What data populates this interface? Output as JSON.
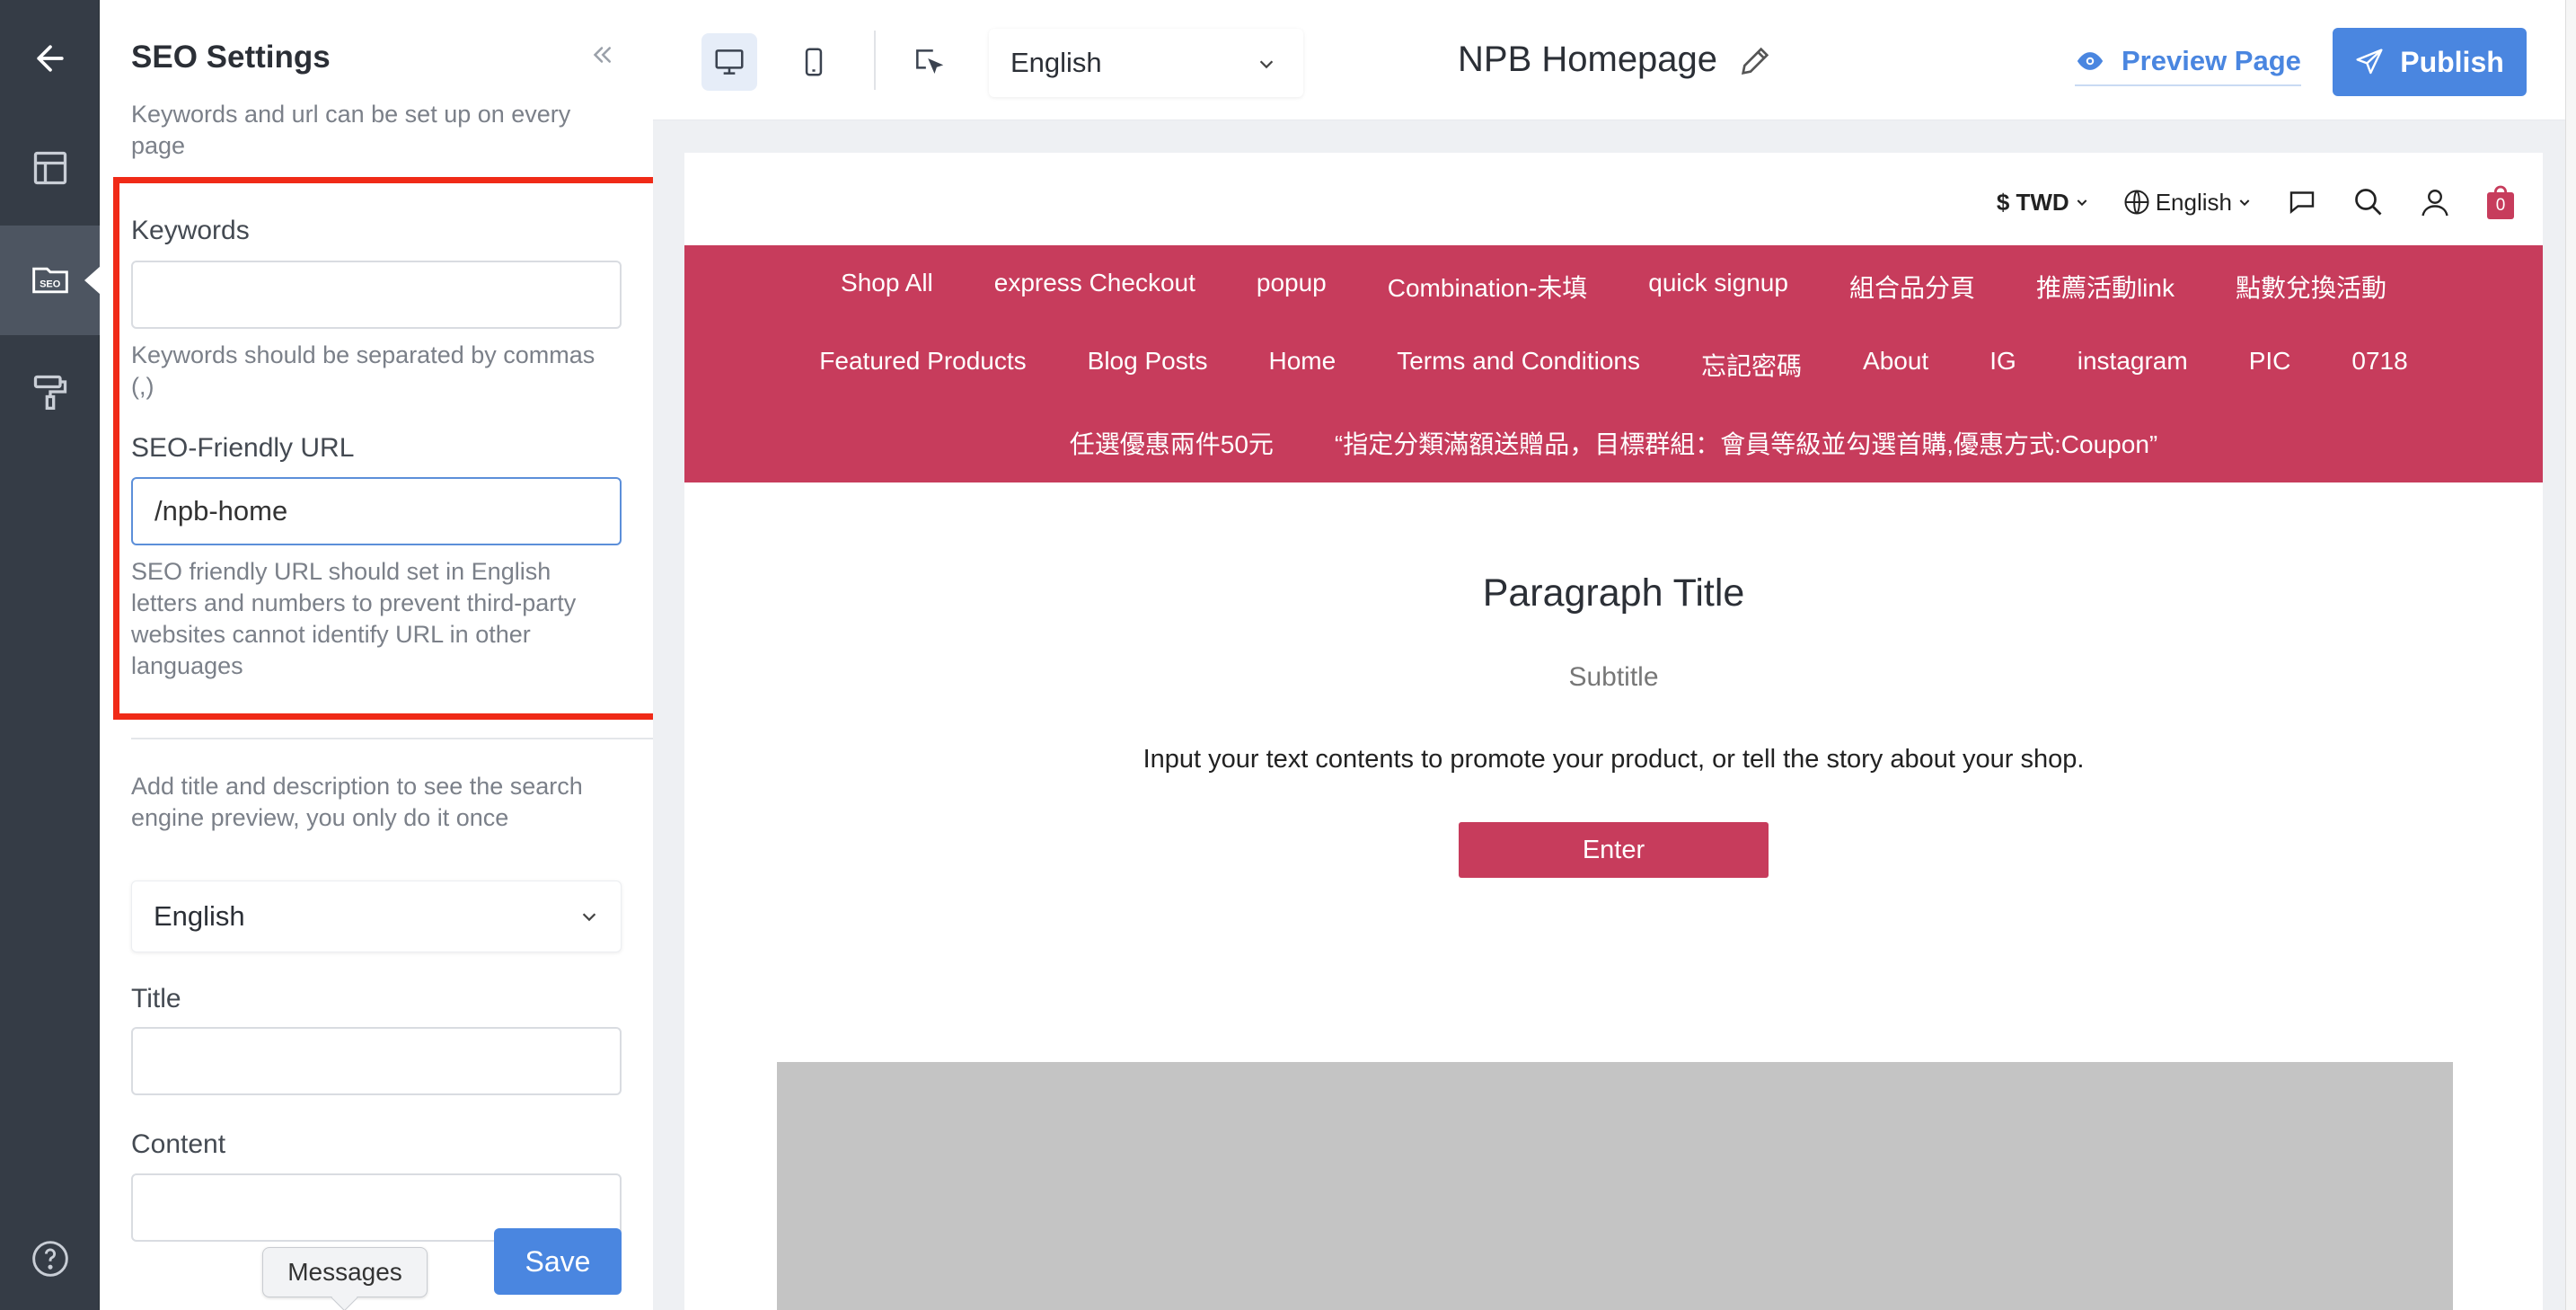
{
  "sidebar": {
    "items": [
      {
        "name": "back",
        "icon": "arrow-left-icon"
      },
      {
        "name": "layout",
        "icon": "layout-icon"
      },
      {
        "name": "seo",
        "icon": "seo-icon",
        "active": true,
        "icon_text": "SEO"
      },
      {
        "name": "design",
        "icon": "paint-roller-icon"
      },
      {
        "name": "help",
        "icon": "help-circle-icon"
      }
    ]
  },
  "panel": {
    "title": "SEO Settings",
    "description": "Keywords and url can be set up on every page",
    "keywords": {
      "label": "Keywords",
      "value": "",
      "help": "Keywords should be separated by commas (,)"
    },
    "seo_url": {
      "label": "SEO-Friendly URL",
      "value": "/npb-home",
      "help": "SEO friendly URL should set in English letters and numbers to prevent third-party websites cannot identify URL in other languages"
    },
    "preview_hint": "Add title and description to see the search engine preview, you only do it once",
    "language": "English",
    "title_field": {
      "label": "Title",
      "value": ""
    },
    "content_field": {
      "label": "Content",
      "value": ""
    },
    "save_label": "Save",
    "tooltip": "Messages"
  },
  "topbar": {
    "devices": [
      "desktop-icon",
      "mobile-icon"
    ],
    "language": "English",
    "page_title": "NPB Homepage",
    "preview_label": "Preview Page",
    "publish_label": "Publish",
    "accent": "#4a86e0"
  },
  "preview": {
    "currency": "$ TWD",
    "language": "English",
    "cart_count": "0",
    "brand_color": "#c73c5c",
    "nav_rows": [
      [
        "Shop All",
        "express Checkout",
        "popup",
        "Combination-未填",
        "quick signup",
        "組合品分頁",
        "推薦活動link",
        "點數兌換活動"
      ],
      [
        "Featured Products",
        "Blog Posts",
        "Home",
        "Terms and Conditions",
        "忘記密碼",
        "About",
        "IG",
        "instagram",
        "PIC",
        "0718"
      ],
      [
        "任選優惠兩件50元",
        "“指定分類滿額送贈品，目標群組：會員等級並勾選首購,優惠方式:Coupon”"
      ]
    ],
    "paragraph_title": "Paragraph Title",
    "subtitle": "Subtitle",
    "body": "Input your text contents to promote your product, or tell the story about your shop.",
    "button_label": "Enter"
  }
}
